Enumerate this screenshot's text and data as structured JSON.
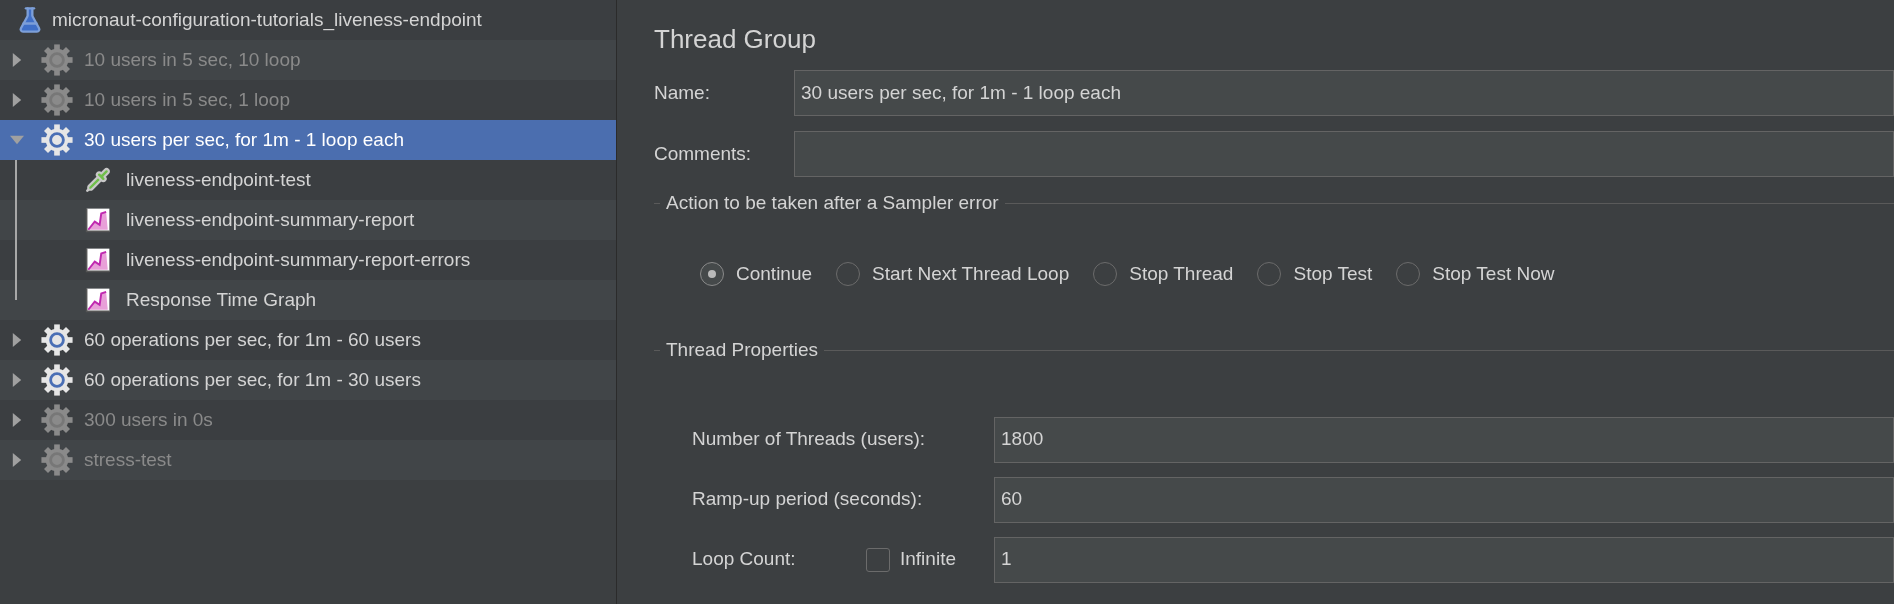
{
  "test_plan": {
    "name": "micronaut-configuration-tutorials_liveness-endpoint",
    "children": [
      {
        "kind": "thread-group",
        "name": "10 users in 5 sec, 10 loop",
        "enabled": false,
        "expanded": false,
        "selected": false
      },
      {
        "kind": "thread-group",
        "name": "10 users in 5 sec, 1 loop",
        "enabled": false,
        "expanded": false,
        "selected": false
      },
      {
        "kind": "thread-group",
        "name": "30 users per sec, for 1m - 1 loop each",
        "enabled": true,
        "expanded": true,
        "selected": true,
        "children": [
          {
            "kind": "sampler",
            "name": "liveness-endpoint-test",
            "enabled": true,
            "selected": false
          },
          {
            "kind": "listener",
            "name": "liveness-endpoint-summary-report",
            "enabled": true,
            "selected": false
          },
          {
            "kind": "listener",
            "name": "liveness-endpoint-summary-report-errors",
            "enabled": true,
            "selected": false
          },
          {
            "kind": "listener",
            "name": "Response Time Graph",
            "enabled": true,
            "selected": false
          }
        ]
      },
      {
        "kind": "thread-group",
        "name": "60 operations per sec, for 1m - 60 users",
        "enabled": true,
        "expanded": false,
        "selected": false
      },
      {
        "kind": "thread-group",
        "name": "60 operations per sec, for 1m - 30 users",
        "enabled": true,
        "expanded": false,
        "selected": false
      },
      {
        "kind": "thread-group",
        "name": "300 users in 0s",
        "enabled": false,
        "expanded": false,
        "selected": false
      },
      {
        "kind": "thread-group",
        "name": "stress-test",
        "enabled": false,
        "expanded": false,
        "selected": false
      }
    ]
  },
  "panel": {
    "title": "Thread Group",
    "name_field": {
      "label": "Name:",
      "value": "30 users per sec, for 1m - 1 loop each"
    },
    "comments_field": {
      "label": "Comments:"
    },
    "error_action": {
      "title": "Action to be taken after a Sampler error",
      "options": [
        {
          "label": "Continue",
          "selected": true
        },
        {
          "label": "Start Next Thread Loop",
          "selected": false
        },
        {
          "label": "Stop Thread",
          "selected": false
        },
        {
          "label": "Stop Test",
          "selected": false
        },
        {
          "label": "Stop Test Now",
          "selected": false
        }
      ]
    },
    "thread_properties": {
      "title": "Thread Properties",
      "threads": {
        "label": "Number of Threads (users):",
        "value": "1800"
      },
      "ramp_up": {
        "label": "Ramp-up period (seconds):",
        "value": "60"
      },
      "loop_count": {
        "label": "Loop Count:",
        "infinite": {
          "label": "Infinite",
          "checked": false
        },
        "value": "1"
      }
    }
  }
}
